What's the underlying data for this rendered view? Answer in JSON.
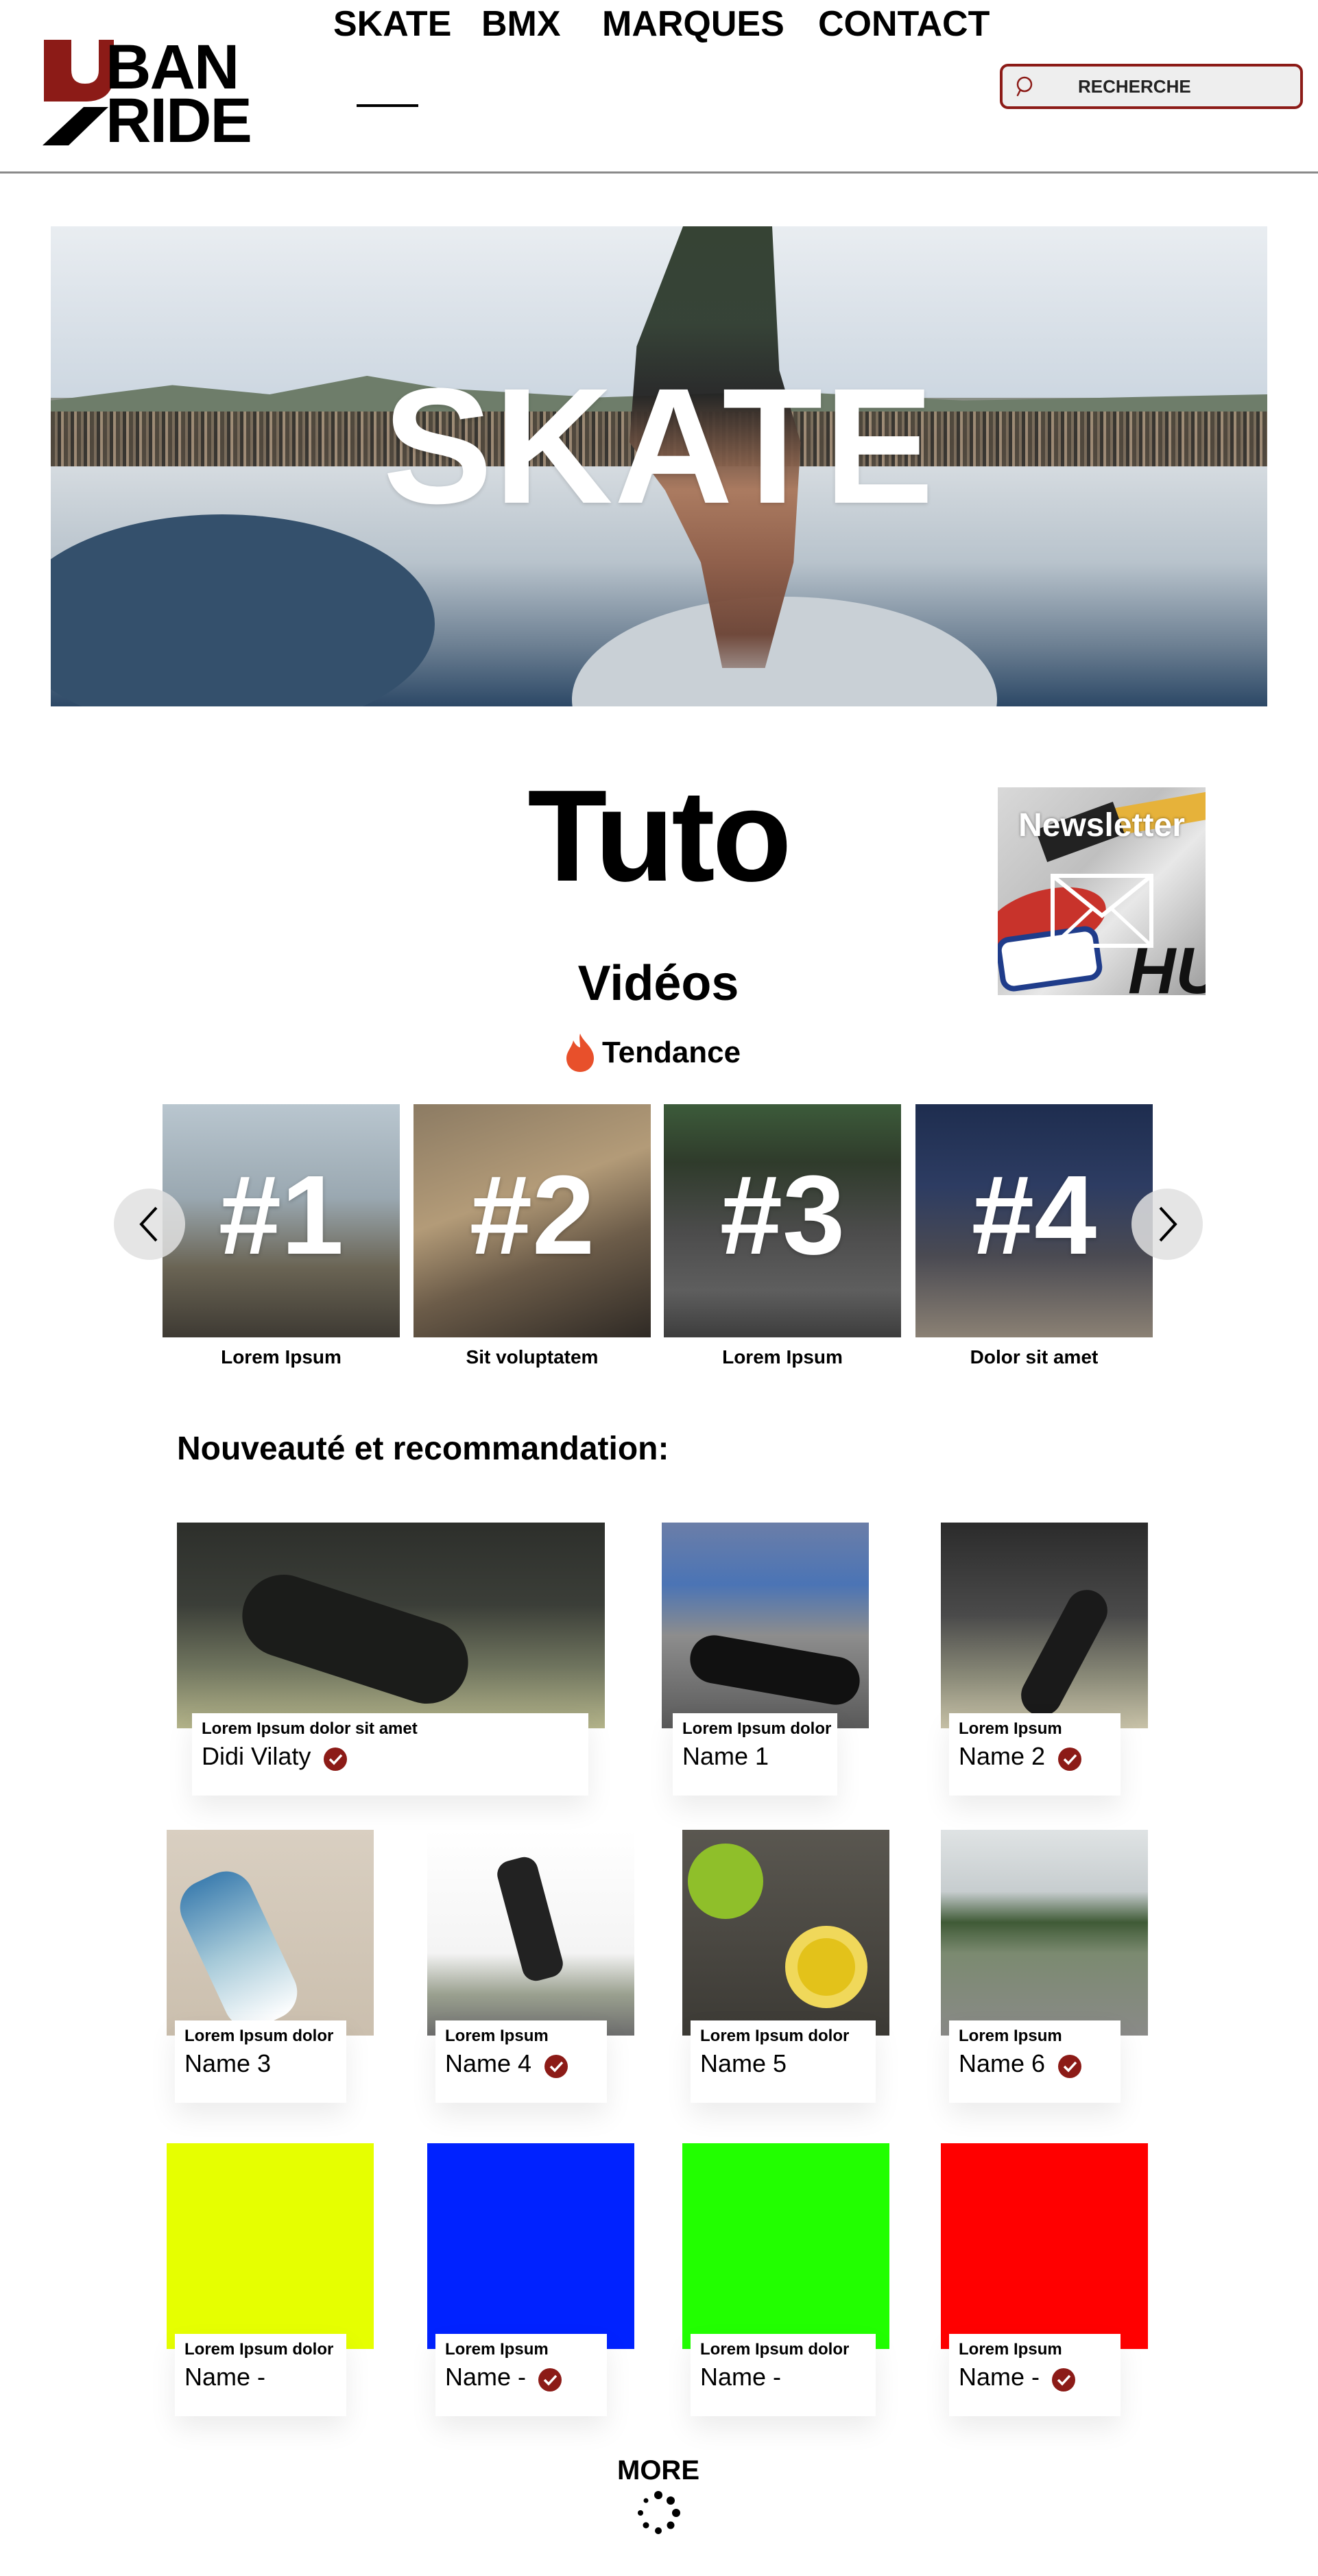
{
  "header": {
    "logo": {
      "line1": "BAN",
      "line2": "RIDE",
      "accent_color": "#8c1b17"
    },
    "nav": [
      {
        "label": "SKATE",
        "active": true
      },
      {
        "label": "BMX",
        "active": false
      },
      {
        "label": "MARQUES",
        "active": false
      },
      {
        "label": "CONTACT",
        "active": false
      }
    ],
    "search": {
      "placeholder": "RECHERCHE",
      "icon": "search-icon"
    }
  },
  "hero": {
    "title": "SKATE"
  },
  "tuto": {
    "title": "Tuto",
    "videos_title": "Vidéos",
    "tendance_label": "Tendance",
    "tendance_icon": "flame-icon"
  },
  "newsletter": {
    "title": "Newsletter",
    "icon": "mail-icon"
  },
  "carousel": {
    "prev_icon": "chevron-left-icon",
    "next_icon": "chevron-right-icon",
    "videos": [
      {
        "rank": "#1",
        "label": "Lorem Ipsum"
      },
      {
        "rank": "#2",
        "label": "Sit voluptatem"
      },
      {
        "rank": "#3",
        "label": "Lorem Ipsum"
      },
      {
        "rank": "#4",
        "label": "Dolor sit amet"
      }
    ]
  },
  "recommendations": {
    "heading": "Nouveauté et recommandation:",
    "cards": [
      {
        "title": "Lorem Ipsum dolor sit amet",
        "name": "Didi Vilaty",
        "verified": true
      },
      {
        "title": "Lorem Ipsum dolor",
        "name": "Name 1",
        "verified": false
      },
      {
        "title": "Lorem Ipsum",
        "name": "Name 2",
        "verified": true
      },
      {
        "title": "Lorem Ipsum dolor",
        "name": "Name 3",
        "verified": false
      },
      {
        "title": "Lorem Ipsum",
        "name": "Name 4",
        "verified": true
      },
      {
        "title": "Lorem Ipsum dolor",
        "name": "Name 5",
        "verified": false
      },
      {
        "title": "Lorem Ipsum",
        "name": "Name 6",
        "verified": true
      },
      {
        "title": "Lorem Ipsum dolor",
        "name": "Name -",
        "verified": false,
        "image_color": "#e6ff00"
      },
      {
        "title": "Lorem Ipsum",
        "name": "Name -",
        "verified": true,
        "image_color": "#0022ff"
      },
      {
        "title": "Lorem Ipsum dolor",
        "name": "Name -",
        "verified": false,
        "image_color": "#22ff00"
      },
      {
        "title": "Lorem Ipsum",
        "name": "Name -",
        "verified": true,
        "image_color": "#ff0000"
      }
    ]
  },
  "footer": {
    "more_label": "MORE",
    "loading_icon": "spinner-icon"
  },
  "colors": {
    "accent": "#8c1b17",
    "text": "#000000",
    "background": "#ffffff"
  }
}
